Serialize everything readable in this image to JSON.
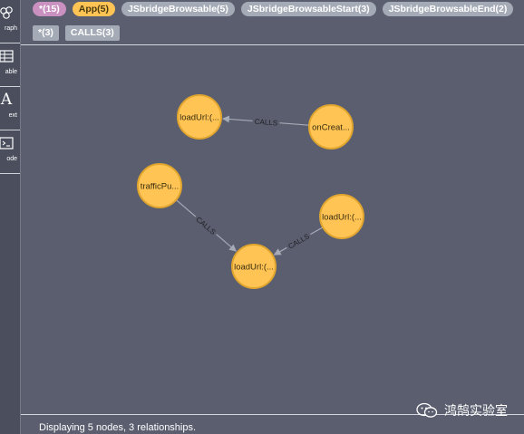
{
  "sidebar": {
    "items": [
      {
        "label": "raph",
        "icon": "graph-icon"
      },
      {
        "label": "able",
        "icon": "table-icon"
      },
      {
        "label": "ext",
        "icon": "text-icon",
        "glyph": "A"
      },
      {
        "label": "ode",
        "icon": "code-icon"
      }
    ]
  },
  "node_labels": [
    {
      "label": "*(15)",
      "color": "#c990c0"
    },
    {
      "label": "App(5)",
      "color": "#ffc454"
    },
    {
      "label": "JSbridgeBrowsable(5)",
      "color": "#a5abb6"
    },
    {
      "label": "JSbridgeBrowsableStart(3)",
      "color": "#a5abb6"
    },
    {
      "label": "JSbridgeBrowsableEnd(2)",
      "color": "#a5abb6"
    }
  ],
  "relationship_types": [
    {
      "label": "*(3)"
    },
    {
      "label": "CALLS(3)"
    }
  ],
  "graph": {
    "nodes": [
      {
        "id": "n1",
        "caption": "loadUrl:(..."
      },
      {
        "id": "n2",
        "caption": "onCreat..."
      },
      {
        "id": "n3",
        "caption": "trafficPu..."
      },
      {
        "id": "n4",
        "caption": "loadUrl:(..."
      },
      {
        "id": "n5",
        "caption": "loadUrl:(..."
      }
    ],
    "relationships": [
      {
        "from": "n2",
        "to": "n1",
        "type": "CALLS"
      },
      {
        "from": "n3",
        "to": "n5",
        "type": "CALLS"
      },
      {
        "from": "n4",
        "to": "n5",
        "type": "CALLS"
      }
    ],
    "node_color": "#ffc454",
    "node_border": "#e0a52e",
    "edge_color": "#a5abb6"
  },
  "status": "Displaying 5 nodes, 3 relationships.",
  "watermark": {
    "text": "鸿鹄实验室",
    "icon": "wechat-icon"
  }
}
